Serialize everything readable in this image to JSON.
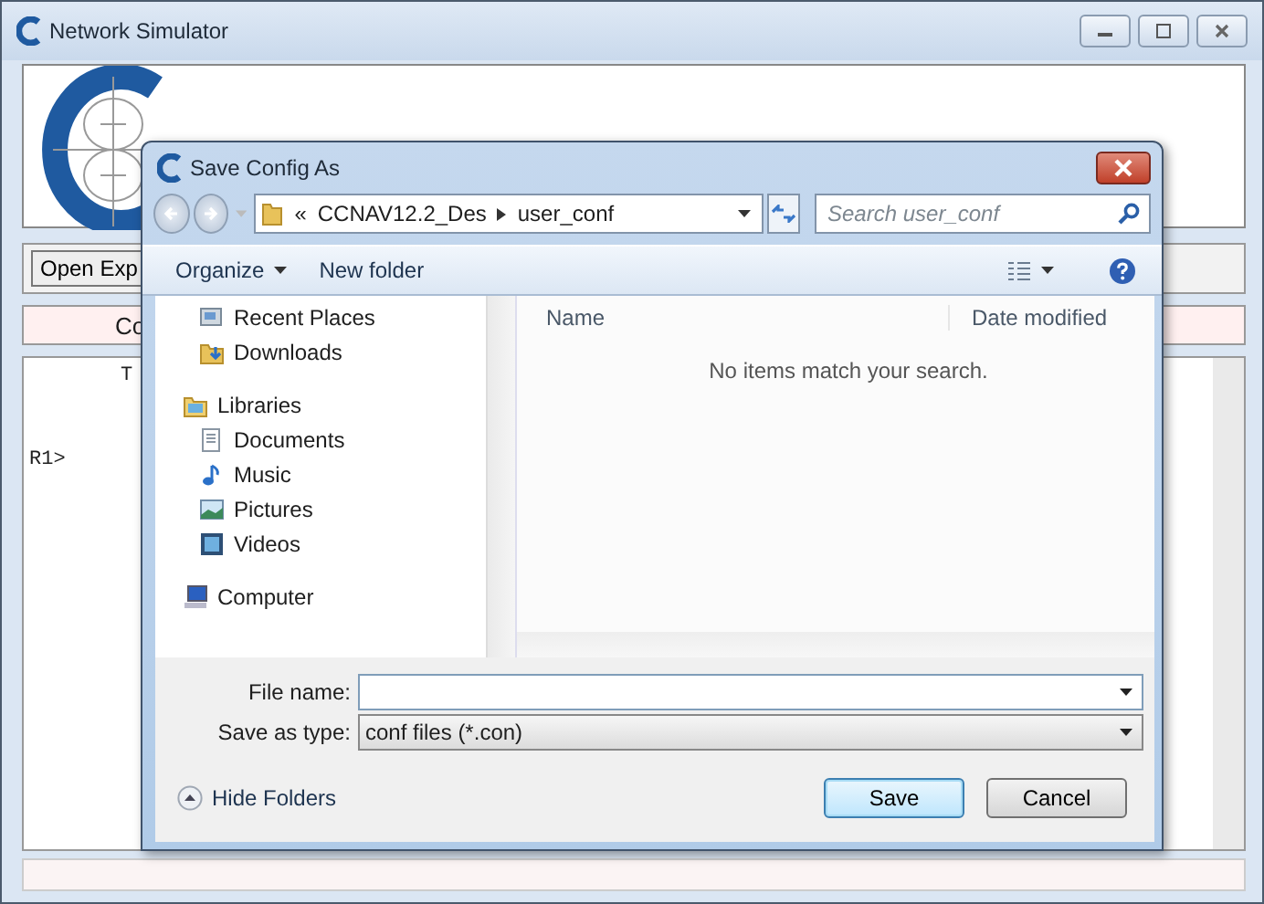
{
  "main_window": {
    "title": "Network Simulator"
  },
  "toolbar": {
    "button": "Open Exp"
  },
  "header": {
    "label": "Co"
  },
  "console": {
    "lines": [
      "T",
      "R1>"
    ]
  },
  "dialog": {
    "title": "Save Config As",
    "address": {
      "overflow": "«",
      "path": [
        "CCNAV12.2_Des",
        "user_conf"
      ]
    },
    "search": {
      "placeholder": "Search user_conf"
    },
    "commands": [
      {
        "label": "Organize",
        "kind": "menu"
      },
      {
        "label": "New folder",
        "kind": "plain"
      }
    ],
    "nav": [
      {
        "label": "Recent Places",
        "kind": "recent"
      },
      {
        "label": "Downloads",
        "kind": "downloads"
      },
      {
        "label": "Libraries",
        "kind": "libraries",
        "children": [
          {
            "label": "Documents",
            "kind": "documents"
          },
          {
            "label": "Music",
            "kind": "music"
          },
          {
            "label": "Pictures",
            "kind": "pictures"
          },
          {
            "label": "Videos",
            "kind": "videos"
          }
        ]
      },
      {
        "label": "Computer",
        "kind": "computer"
      }
    ],
    "columns": [
      "Name",
      "Date modified"
    ],
    "empty_message": "No items match your search.",
    "file_name": {
      "label": "File name:"
    },
    "save_type": {
      "label": "Save as type:",
      "value": "conf files (*.con)"
    },
    "hide_folders": "Hide Folders",
    "buttons": [
      {
        "label": "Save",
        "default": true
      },
      {
        "label": "Cancel",
        "default": false
      }
    ]
  }
}
